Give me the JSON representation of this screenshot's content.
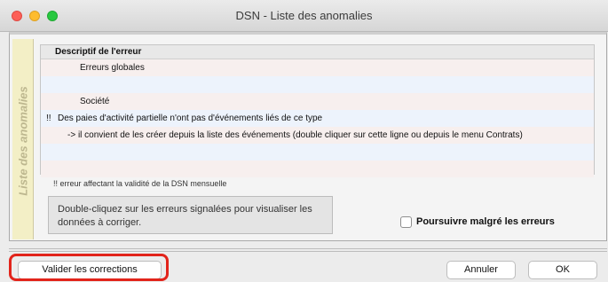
{
  "window": {
    "title": "DSN - Liste des anomalies"
  },
  "sidebar": {
    "tab_label": "Liste des anomalies"
  },
  "table": {
    "header": "Descriptif de l'erreur",
    "rows": [
      {
        "mark": "",
        "text": "Erreurs globales"
      },
      {
        "mark": "",
        "text": ""
      },
      {
        "mark": "",
        "text": "Société"
      },
      {
        "mark": "!!",
        "text": "Des paies d'activité partielle n'ont pas d'événements liés de ce type"
      },
      {
        "mark": "",
        "text": "-> il convient de les créer depuis la liste des événements (double cliquer sur cette ligne ou depuis le menu Contrats)"
      },
      {
        "mark": "",
        "text": ""
      },
      {
        "mark": "",
        "text": ""
      }
    ]
  },
  "footnote": "!! erreur affectant la validité de la DSN mensuelle",
  "hint": "Double-cliquez sur les erreurs signalées pour visualiser les données à corriger.",
  "checkbox": {
    "label": "Poursuivre malgré les erreurs",
    "checked": false
  },
  "buttons": {
    "validate": "Valider les corrections",
    "cancel": "Annuler",
    "ok": "OK"
  },
  "colors": {
    "highlight": "#e2241b",
    "tab_background": "#f3efc6"
  }
}
